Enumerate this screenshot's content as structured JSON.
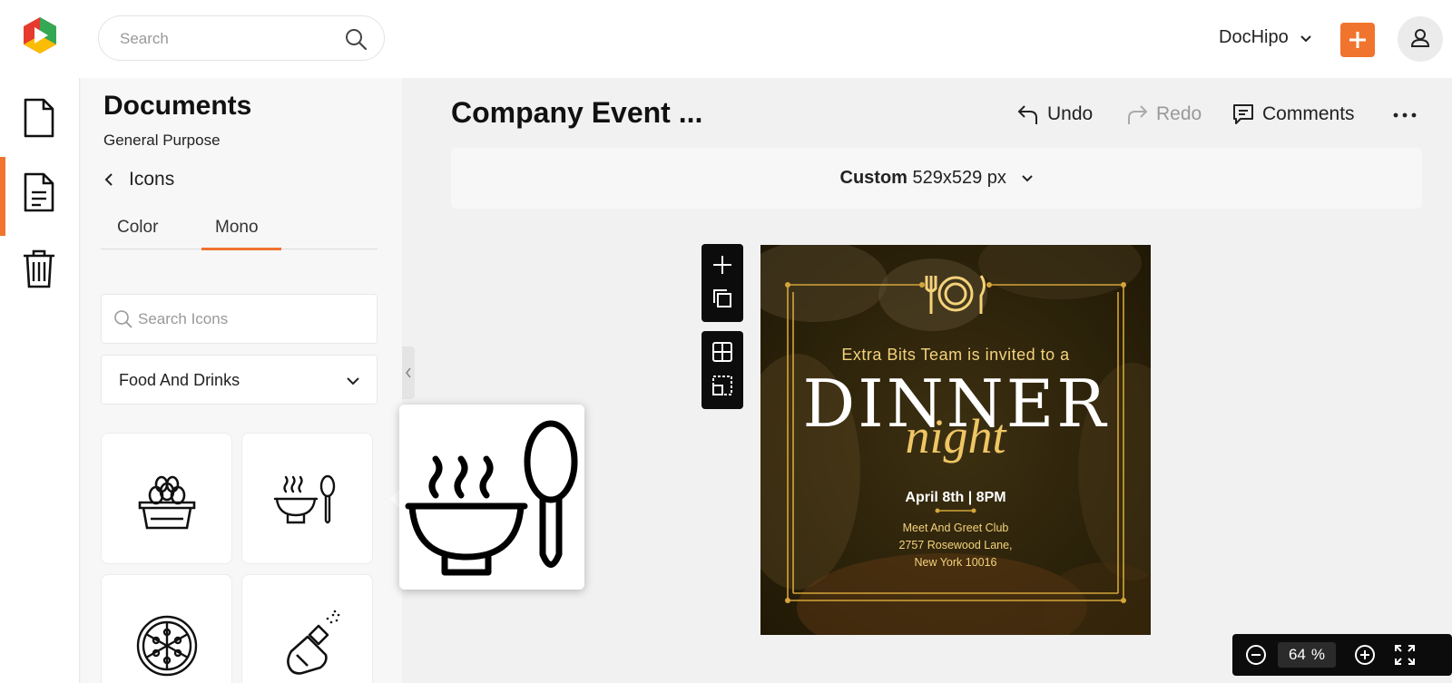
{
  "header": {
    "search_placeholder": "Search",
    "account_name": "DocHipo"
  },
  "sidebar": {
    "title": "Documents",
    "subtitle": "General Purpose",
    "back_label": "Icons",
    "tabs": [
      {
        "label": "Color",
        "active": false
      },
      {
        "label": "Mono",
        "active": true
      }
    ],
    "icon_search_placeholder": "Search Icons",
    "category": "Food And Drinks",
    "icons": [
      "egg-basket-icon",
      "soup-bowl-spoon-icon",
      "pizza-icon",
      "salt-shaker-icon"
    ]
  },
  "editor": {
    "doc_title": "Company Event ...",
    "undo_label": "Undo",
    "redo_label": "Redo",
    "comments_label": "Comments",
    "size_preset": "Custom",
    "size_value": "529x529 px"
  },
  "design": {
    "invited_line": "Extra Bits Team is invited to a",
    "headline": "DINNER",
    "script_line": "night",
    "date_line": "April 8th | 8PM",
    "venue": "Meet And Greet Club",
    "street": "2757 Rosewood Lane,",
    "city": "New York 10016"
  },
  "zoom": {
    "value": "64",
    "unit": "%"
  },
  "colors": {
    "accent": "#f0742e",
    "gold": "#efc664",
    "toolbar_dark": "#0c0c0c"
  }
}
